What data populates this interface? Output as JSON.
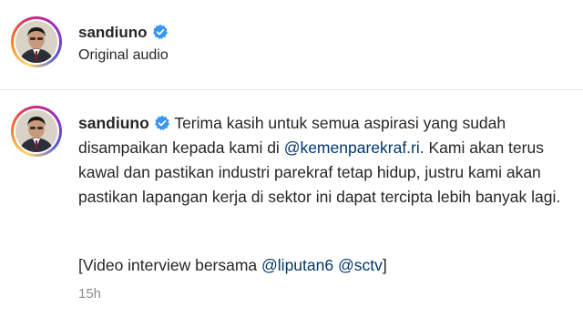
{
  "header": {
    "username": "sandiuno",
    "subtitle": "Original audio"
  },
  "caption": {
    "username": "sandiuno",
    "text_1": "Terima kasih untuk semua aspirasi yang sudah disampaikan kepada kami di ",
    "mention_1": "@kemenparekraf.ri",
    "text_2": ". Kami akan terus kawal dan pastikan industri parekraf tetap hidup, justru kami akan pastikan lapangan kerja di sektor ini dapat tercipta lebih banyak lagi.",
    "line2_prefix": "[Video interview bersama ",
    "mention_2": "@liputan6",
    "mention_3": "@sctv",
    "line2_suffix": "]",
    "timestamp": "15h"
  },
  "colors": {
    "verified": "#3897f0",
    "mention": "#00376b",
    "muted": "#8e8e8e"
  },
  "icons": {
    "verified": "verified-badge-icon"
  }
}
